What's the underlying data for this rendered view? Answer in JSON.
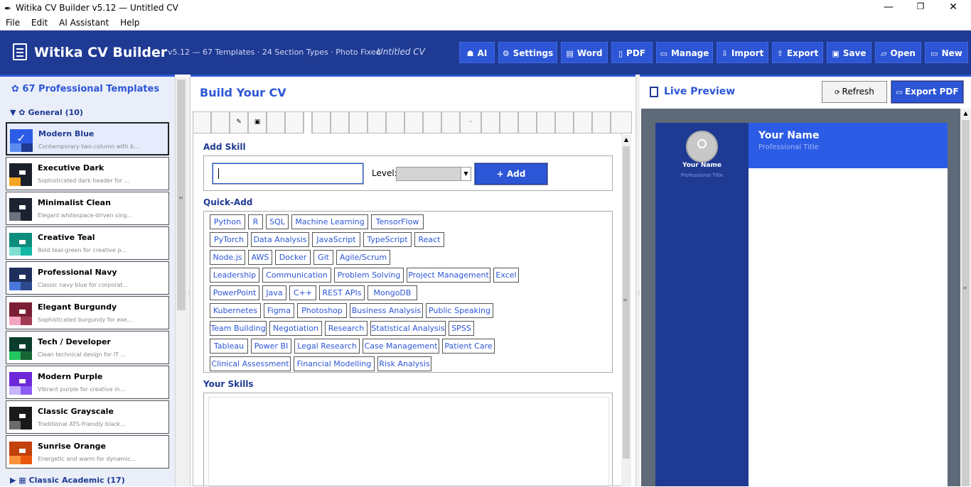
{
  "window": {
    "title": "Witika CV Builder v5.12  —  Untitled CV"
  },
  "menu": [
    "File",
    "Edit",
    "AI Assistant",
    "Help"
  ],
  "header": {
    "app_name": "Witika CV Builder",
    "subtitle": "v5.12 — 67 Templates · 24 Section Types · Photo Fixed",
    "doc_name": "Untitled CV",
    "buttons": [
      {
        "label": "AI",
        "icon": "robot-icon"
      },
      {
        "label": "Settings",
        "icon": "gear-icon"
      },
      {
        "label": "Word",
        "icon": "word-icon"
      },
      {
        "label": "PDF",
        "icon": "pdf-icon"
      },
      {
        "label": "Manage",
        "icon": "folder-icon"
      },
      {
        "label": "Import",
        "icon": "import-icon"
      },
      {
        "label": "Export",
        "icon": "export-icon"
      },
      {
        "label": "Save",
        "icon": "save-icon"
      },
      {
        "label": "Open",
        "icon": "open-icon"
      },
      {
        "label": "New",
        "icon": "new-icon"
      }
    ]
  },
  "templates": {
    "heading": "67 Professional Templates",
    "group_general": "General  (10)",
    "group_classic": "Classic Academic  (17)",
    "items": [
      {
        "name": "Modern Blue",
        "desc": "Contemporary two-column with b...",
        "c1": "#2c5ce6",
        "c2": "#1f3a93",
        "c3": "#5b8cf0"
      },
      {
        "name": "Executive Dark",
        "desc": "Sophisticated dark header for ...",
        "c1": "#1a1f2b",
        "c2": "#f5a623",
        "c3": "#ffffff"
      },
      {
        "name": "Minimalist Clean",
        "desc": "Elegant whitespace-driven sing...",
        "c1": "#1c2230",
        "c2": "#6b7280",
        "c3": "#ffffff"
      },
      {
        "name": "Creative Teal",
        "desc": "Bold teal-green for creative p...",
        "c1": "#0e8c7d",
        "c2": "#14b8a6",
        "c3": "#7fe0d2"
      },
      {
        "name": "Professional Navy",
        "desc": "Classic navy blue for corporat...",
        "c1": "#1e2f5c",
        "c2": "#4a78d9",
        "c3": "#2c4a8f"
      },
      {
        "name": "Elegant Burgundy",
        "desc": "Sophisticated burgundy for exe...",
        "c1": "#7a1f33",
        "c2": "#f4a4c0",
        "c3": "#a33a54"
      },
      {
        "name": "Tech / Developer",
        "desc": "Clean technical design for IT ...",
        "c1": "#0b3d2e",
        "c2": "#22c55e",
        "c3": "#166534"
      },
      {
        "name": "Modern Purple",
        "desc": "Vibrant purple for creative in...",
        "c1": "#6d28d9",
        "c2": "#c4b5fd",
        "c3": "#8b5cf6"
      },
      {
        "name": "Classic Grayscale",
        "desc": "Traditional ATS-friendly black...",
        "c1": "#1a1a1a",
        "c2": "#6b6b6b",
        "c3": "#ffffff"
      },
      {
        "name": "Sunrise Orange",
        "desc": "Energetic and warm for dynamic...",
        "c1": "#c2410c",
        "c2": "#fb923c",
        "c3": "#ea580c"
      }
    ]
  },
  "build": {
    "title": "Build Your CV",
    "tabs": [
      "",
      "",
      "✎",
      "▣",
      "",
      "",
      "",
      "",
      "",
      "",
      "",
      "",
      "",
      "",
      "",
      "·",
      "",
      "",
      "",
      "",
      "",
      "",
      ""
    ],
    "add_skill_label": "Add Skill",
    "skill_input_value": "",
    "level_label": "Level:",
    "level_value": "",
    "add_button": "+  Add",
    "quick_add_label": "Quick-Add",
    "quick_add": [
      [
        "Python",
        "R",
        "SQL",
        "Machine Learning",
        "TensorFlow"
      ],
      [
        "PyTorch",
        "Data Analysis",
        "JavaScript",
        "TypeScript",
        "React"
      ],
      [
        "Node.js",
        "AWS",
        "Docker",
        "Git",
        "Agile/Scrum"
      ],
      [
        "Leadership",
        "Communication",
        "Problem Solving",
        "Project Management",
        "Excel"
      ],
      [
        "PowerPoint",
        "Java",
        "C++",
        "REST APIs",
        "MongoDB"
      ],
      [
        "Kubernetes",
        "Figma",
        "Photoshop",
        "Business Analysis",
        "Public Speaking"
      ],
      [
        "Team Building",
        "Negotiation",
        "Research",
        "Statistical Analysis",
        "SPSS"
      ],
      [
        "Tableau",
        "Power BI",
        "Legal Research",
        "Case Management",
        "Patient Care"
      ],
      [
        "Clinical Assessment",
        "Financial Modelling",
        "Risk Analysis"
      ]
    ],
    "your_skills_label": "Your Skills"
  },
  "preview": {
    "title": "Live Preview",
    "refresh": "Refresh",
    "export_pdf": "Export PDF",
    "cv_name": "Your Name",
    "cv_title": "Professional Title",
    "side_name": "Your Name",
    "side_title": "Professional Title"
  },
  "colors": {
    "accent": "#2c56d6",
    "header_bg": "#1f3a93"
  }
}
